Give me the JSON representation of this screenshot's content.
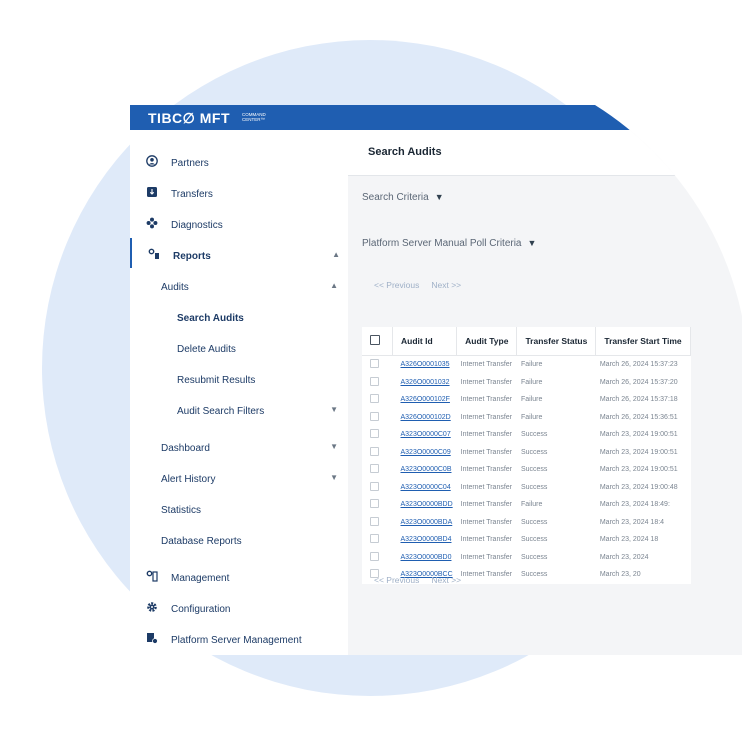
{
  "brand": {
    "name": "TIBC∅ MFT",
    "sub": "COMMAND CENTER™"
  },
  "sidebar": {
    "items": [
      {
        "label": "Partners"
      },
      {
        "label": "Transfers"
      },
      {
        "label": "Diagnostics"
      },
      {
        "label": "Reports"
      },
      {
        "label": "Audits"
      },
      {
        "label": "Search Audits"
      },
      {
        "label": "Delete Audits"
      },
      {
        "label": "Resubmit Results"
      },
      {
        "label": "Audit Search Filters"
      },
      {
        "label": "Dashboard"
      },
      {
        "label": "Alert History"
      },
      {
        "label": "Statistics"
      },
      {
        "label": "Database Reports"
      },
      {
        "label": "Management"
      },
      {
        "label": "Configuration"
      },
      {
        "label": "Platform Server Management"
      }
    ]
  },
  "main": {
    "title": "Search Audits",
    "search_criteria": "Search Criteria",
    "poll_criteria": "Platform Server Manual Poll Criteria",
    "pager": {
      "prev": "<< Previous",
      "next": "Next >>"
    },
    "table": {
      "headers": [
        "Audit Id",
        "Audit Type",
        "Transfer Status",
        "Transfer Start Time"
      ],
      "rows": [
        [
          "A326O0001035",
          "Internet Transfer",
          "Failure",
          "March 26, 2024 15:37:23"
        ],
        [
          "A326O0001032",
          "Internet Transfer",
          "Failure",
          "March 26, 2024 15:37:20"
        ],
        [
          "A326O000102F",
          "Internet Transfer",
          "Failure",
          "March 26, 2024 15:37:18"
        ],
        [
          "A326O000102D",
          "Internet Transfer",
          "Failure",
          "March 26, 2024 15:36:51"
        ],
        [
          "A323O0000C07",
          "Internet Transfer",
          "Success",
          "March 23, 2024 19:00:51"
        ],
        [
          "A323O0000C09",
          "Internet Transfer",
          "Success",
          "March 23, 2024 19:00:51"
        ],
        [
          "A323O0000C0B",
          "Internet Transfer",
          "Success",
          "March 23, 2024 19:00:51"
        ],
        [
          "A323O0000C04",
          "Internet Transfer",
          "Success",
          "March 23, 2024 19:00:48"
        ],
        [
          "A323O0000BDD",
          "Internet Transfer",
          "Failure",
          "March 23, 2024 18:49:"
        ],
        [
          "A323O0000BDA",
          "Internet Transfer",
          "Success",
          "March 23, 2024 18:4"
        ],
        [
          "A323O0000BD4",
          "Internet Transfer",
          "Success",
          "March 23, 2024 18"
        ],
        [
          "A323O0000BD0",
          "Internet Transfer",
          "Success",
          "March 23, 2024"
        ],
        [
          "A323O0000BCC",
          "Internet Transfer",
          "Success",
          "March 23, 20"
        ]
      ]
    }
  }
}
